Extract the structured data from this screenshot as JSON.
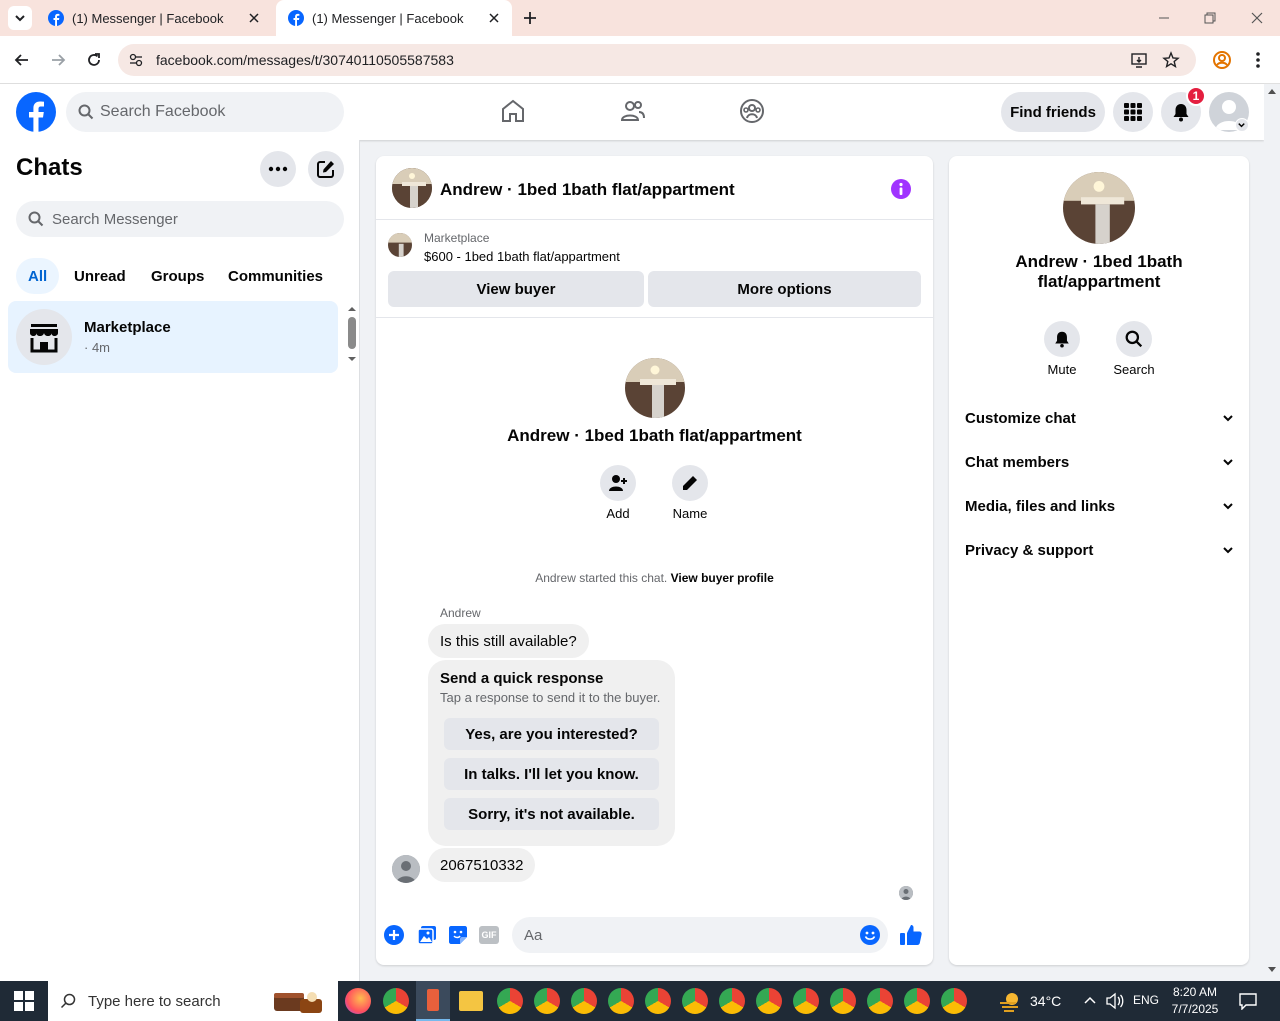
{
  "browser": {
    "tabs": [
      {
        "title": "(1) Messenger | Facebook"
      },
      {
        "title": "(1) Messenger | Facebook"
      }
    ],
    "url": "facebook.com/messages/t/30740110505587583"
  },
  "fb_nav": {
    "search_placeholder": "Search Facebook",
    "find_friends": "Find friends",
    "notification_count": "1"
  },
  "sidebar": {
    "title": "Chats",
    "search_placeholder": "Search Messenger",
    "filters": [
      "All",
      "Unread",
      "Groups",
      "Communities"
    ],
    "active_filter": "All",
    "chat": {
      "name": "Marketplace",
      "time": "· 4m"
    }
  },
  "conversation": {
    "header_title": "Andrew · 1bed 1bath flat/appartment",
    "listing_source": "Marketplace",
    "listing_title": "$600 - 1bed 1bath flat/appartment",
    "view_buyer": "View buyer",
    "more_options": "More options",
    "profile_name": "Andrew · 1bed 1bath flat/appartment",
    "add_label": "Add",
    "name_label": "Name",
    "started_text": "Andrew started this chat.",
    "view_profile_link": "View buyer profile",
    "sender": "Andrew",
    "message1": "Is this still available?",
    "quick_title": "Send a quick response",
    "quick_sub": "Tap a response to send it to the buyer.",
    "quick_responses": [
      "Yes, are you interested?",
      "In talks. I'll let you know.",
      "Sorry, it's not available."
    ],
    "message2": "2067510332",
    "composer_placeholder": "Aa",
    "gif_label": "GIF"
  },
  "info_panel": {
    "name_line1": "Andrew · 1bed 1bath",
    "name_line2": "flat/appartment",
    "mute": "Mute",
    "search": "Search",
    "sections": [
      "Customize chat",
      "Chat members",
      "Media, files and links",
      "Privacy & support"
    ]
  },
  "taskbar": {
    "search_placeholder": "Type here to search",
    "temperature": "34°C",
    "language": "ENG",
    "time": "8:20 AM",
    "date": "7/7/2025"
  },
  "colors": {
    "fb_blue": "#0866ff",
    "messenger_purple": "#a033ff",
    "selected_chat": "#e7f3ff",
    "notification_red": "#e41e3f"
  }
}
